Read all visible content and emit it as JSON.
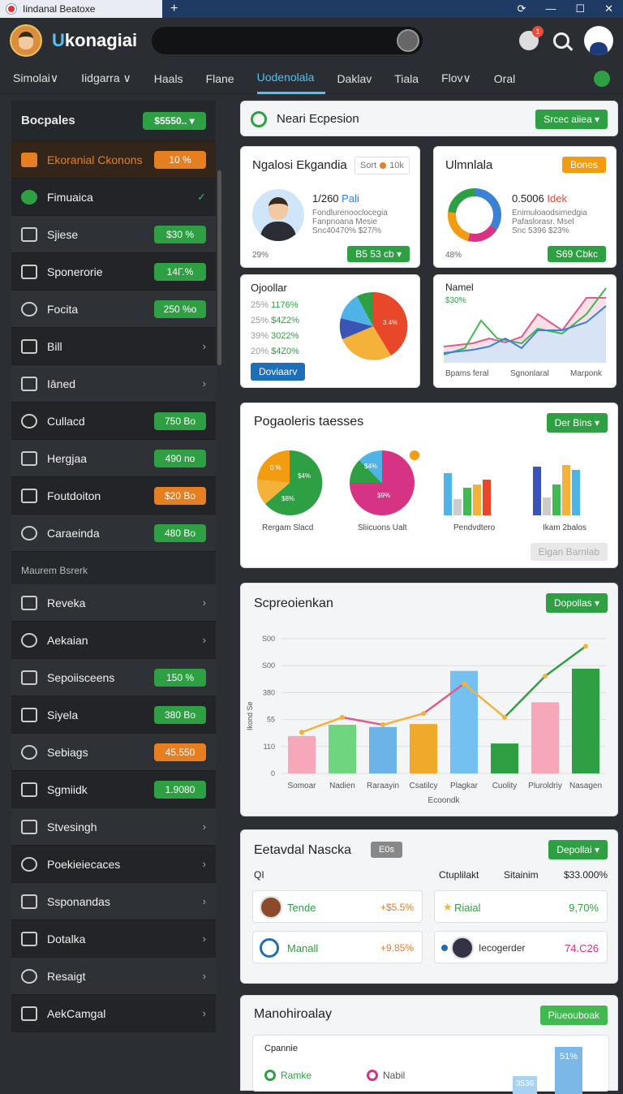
{
  "window": {
    "tab_title": "Iindanal Beatoxe",
    "plus": "+",
    "controls": [
      "⟳",
      "—",
      "☐",
      "✕"
    ]
  },
  "header": {
    "brand_u": "U",
    "brand_rest": "konagiai",
    "notif_count": "1"
  },
  "nav": {
    "items": [
      "Simolai∨",
      "Iidgarra ∨",
      "Haals",
      "Flane",
      "Uodenolala",
      "Daklav",
      "Tiala",
      "Flov∨",
      "Oral"
    ],
    "active_index": 4
  },
  "sidebar": {
    "title": "Bocpales",
    "title_pill": "$5550.. ▾",
    "items": [
      {
        "label": "Ekoranial Ckonons",
        "value": "10 %",
        "style": "orange"
      },
      {
        "label": "Fimuaica",
        "value": "✓",
        "style": "check"
      },
      {
        "label": "Sjiese",
        "value": "$30 %",
        "style": "green"
      },
      {
        "label": "Sponerorie",
        "value": "14Γ.%",
        "style": "green"
      },
      {
        "label": "Focita",
        "value": "250 %o",
        "style": "green"
      },
      {
        "label": "Bill",
        "value": "›",
        "style": "chev"
      },
      {
        "label": "Iāned",
        "value": "›",
        "style": "chev"
      },
      {
        "label": "Cullacd",
        "value": "750 Bo",
        "style": "green"
      },
      {
        "label": "Hergjaa",
        "value": "490 no",
        "style": "green"
      },
      {
        "label": "Foutdoiton",
        "value": "$20 Bo",
        "style": "orange"
      },
      {
        "label": "Caraeinda",
        "value": "480 Bo",
        "style": "green"
      }
    ],
    "section_title": "Maurem Bsrerk",
    "items2": [
      {
        "label": "Reveka",
        "value": "›",
        "style": "chev"
      },
      {
        "label": "Aekaian",
        "value": "›",
        "style": "chev"
      },
      {
        "label": "Sepoiisceens",
        "value": "150 %",
        "style": "green"
      },
      {
        "label": "Siyela",
        "value": "380 Bo",
        "style": "green"
      },
      {
        "label": "Sebiags",
        "value": "45.550",
        "style": "orange"
      },
      {
        "label": "Sgmiidk",
        "value": "1.9080",
        "style": "green"
      },
      {
        "label": "Stvesingh",
        "value": "›",
        "style": "chev"
      },
      {
        "label": "Poekieiecaces",
        "value": "›",
        "style": "chev"
      },
      {
        "label": "Ssponandas",
        "value": "›",
        "style": "chev"
      },
      {
        "label": "Dotalka",
        "value": "›",
        "style": "chev"
      },
      {
        "label": "Resaigt",
        "value": "›",
        "style": "chev"
      },
      {
        "label": "AekCamgal",
        "value": "›",
        "style": "chev"
      }
    ]
  },
  "topbar": {
    "title": "Neari Ecpesion",
    "button": "Srcec aiiea ▾"
  },
  "card1": {
    "title": "Ngalosi Ekgandia",
    "sort": "Sort",
    "sort_val": "10k",
    "big": "1/260",
    "big_accent": "Pali",
    "lines": [
      "Fondlurenooclocegia",
      "Fanpnoana Mesie",
      "Snc40470% $27/%"
    ],
    "foot": "29%",
    "button": "B5 53 cb ▾"
  },
  "card2": {
    "title": "Ulmnlala",
    "button_top": "Bones",
    "big": "0.5006",
    "big_accent": "Idek",
    "lines": [
      "Enimuloaodsimedgia",
      "Pafaslorasr. Msel",
      "Snc 5396 $23%"
    ],
    "foot": "48%",
    "button": "S69 Cbkc"
  },
  "card3": {
    "title": "Ojoollar",
    "rows": [
      [
        "25%",
        "1176%"
      ],
      [
        "25%",
        "$4Z2%"
      ],
      [
        "39%",
        "3022%"
      ],
      [
        "20%",
        "$4Z0%"
      ]
    ],
    "button": "Doviaarv",
    "pie_label": "3.4%"
  },
  "card4": {
    "title": "Namel",
    "sub": "$30%",
    "xlabels": [
      "Bpams feral",
      "Sgnonlaral",
      "Marponk"
    ]
  },
  "card5": {
    "title": "Pogaoleris taesses",
    "button": "Der Bins ▾",
    "pies": [
      {
        "label": "Rergam Slacd",
        "a": "0 %",
        "b": "$4%",
        "c": "$8%"
      },
      {
        "label": "Sliicuons Ualt",
        "a": "$4%",
        "b": "$9%"
      }
    ],
    "bar_labels": [
      "Pendvdtero",
      "Ikam 2balos"
    ],
    "ghost": "Eigan Barnlab"
  },
  "card6": {
    "title": "Scpreoienkan",
    "button": "Dopollas ▾",
    "xaxis_label": "Ecoondk",
    "yaxis_label": "Ikond Se",
    "chart_data": {
      "type": "bar",
      "categories": [
        "Somoar",
        "Nadien",
        "Raraayin",
        "Csatilcy",
        "Plagkar",
        "Cuolity",
        "Pluroldriy",
        "Nasagen"
      ],
      "values": [
        50,
        65,
        62,
        66,
        137,
        40,
        95,
        140
      ],
      "line": [
        55,
        75,
        65,
        80,
        120,
        75,
        130,
        170
      ],
      "yticks": [
        "0",
        "110",
        "55",
        "380",
        "S00",
        "S00"
      ]
    }
  },
  "card7": {
    "title": "Eetavdal Nascka",
    "chip": "E0s",
    "button": "Depollai ▾",
    "h1": "QI",
    "h2": "Ctuplilakt",
    "h3": "Sitainim",
    "h4": "$33.000%",
    "rows": [
      [
        "Tende",
        "+$5.5%",
        "Riaial",
        "9,70%"
      ],
      [
        "Manall",
        "+9.85%",
        "Iecogerder",
        "74.C26"
      ]
    ]
  },
  "card8": {
    "title": "Manohiroalay",
    "button": "Piueouboak",
    "sub": "Cpannie",
    "leg1": "Ramke",
    "leg2": "Nabil",
    "v1": "51%",
    "v2": "3536"
  }
}
